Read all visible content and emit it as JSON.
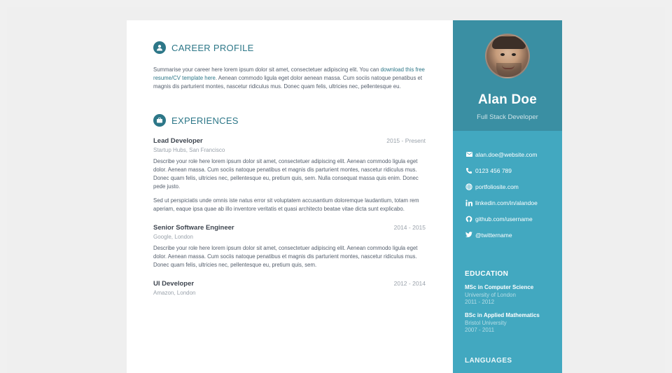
{
  "profile": {
    "name": "Alan Doe",
    "tagline": "Full Stack Developer"
  },
  "contact": [
    {
      "icon": "envelope-icon",
      "text": "alan.doe@website.com"
    },
    {
      "icon": "phone-icon",
      "text": "0123 456 789"
    },
    {
      "icon": "globe-icon",
      "text": "portfoliosite.com"
    },
    {
      "icon": "linkedin-icon",
      "text": "linkedin.com/in/alandoe"
    },
    {
      "icon": "github-icon",
      "text": "github.com/username"
    },
    {
      "icon": "twitter-icon",
      "text": "@twittername"
    }
  ],
  "education": {
    "title": "EDUCATION",
    "items": [
      {
        "degree": "MSc in Computer Science",
        "school": "University of London",
        "years": "2011 - 2012"
      },
      {
        "degree": "BSc in Applied Mathematics",
        "school": "Bristol University",
        "years": "2007 - 2011"
      }
    ]
  },
  "languages": {
    "title": "LANGUAGES"
  },
  "career": {
    "title": "CAREER PROFILE",
    "summary_before": "Summarise your career here lorem ipsum dolor sit amet, consectetuer adipiscing elit. You can ",
    "summary_link": "download this free resume/CV template here",
    "summary_after": ". Aenean commodo ligula eget dolor aenean massa. Cum sociis natoque penatibus et magnis dis parturient montes, nascetur ridiculus mus. Donec quam felis, ultricies nec, pellentesque eu."
  },
  "experiences": {
    "title": "EXPERIENCES",
    "jobs": [
      {
        "title": "Lead Developer",
        "time": "2015 - Present",
        "company": "Startup Hubs, San Francisco",
        "desc1": "Describe your role here lorem ipsum dolor sit amet, consectetuer adipiscing elit. Aenean commodo ligula eget dolor. Aenean massa. Cum sociis natoque penatibus et magnis dis parturient montes, nascetur ridiculus mus. Donec quam felis, ultricies nec, pellentesque eu, pretium quis, sem. Nulla consequat massa quis enim. Donec pede justo.",
        "desc2": "Sed ut perspiciatis unde omnis iste natus error sit voluptatem accusantium doloremque laudantium, totam rem aperiam, eaque ipsa quae ab illo inventore veritatis et quasi architecto beatae vitae dicta sunt explicabo."
      },
      {
        "title": "Senior Software Engineer",
        "time": "2014 - 2015",
        "company": "Google, London",
        "desc1": "Describe your role here lorem ipsum dolor sit amet, consectetuer adipiscing elit. Aenean commodo ligula eget dolor. Aenean massa. Cum sociis natoque penatibus et magnis dis parturient montes, nascetur ridiculus mus. Donec quam felis, ultricies nec, pellentesque eu, pretium quis, sem."
      },
      {
        "title": "UI Developer",
        "time": "2012 - 2014",
        "company": "Amazon, London"
      }
    ]
  },
  "colors": {
    "accent": "#2d7788",
    "sidebar": "#42a8c0",
    "sidebar_header": "#3a8fa3"
  }
}
